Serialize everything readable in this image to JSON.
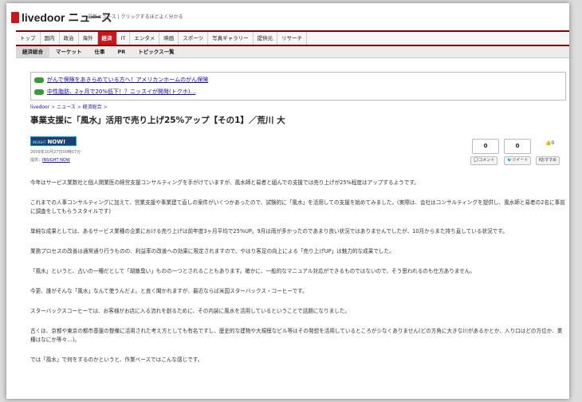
{
  "header": {
    "logo_text": "livedoor ニュース",
    "tagline": "最新ニュース | クリックするほどよく分かる"
  },
  "nav": {
    "items": [
      "トップ",
      "国内",
      "政治",
      "海外",
      "経済",
      "IT",
      "エンタメ",
      "映画",
      "スポーツ",
      "写真ギャラリー",
      "提供元",
      "リサーチ"
    ],
    "active": "経済"
  },
  "subnav": {
    "items": [
      "経済総合",
      "マーケット",
      "仕事",
      "PR",
      "トピックス一覧"
    ],
    "active": "経済総合"
  },
  "promo": {
    "links": [
      "がんで保険をあきらめている方へ！アメリカンホームのがん保険",
      "中性脂肪、2ヶ月で20%低下！？ニッスイが開発(トクホ)…"
    ]
  },
  "breadcrumb": [
    "livedoor",
    "ニュース",
    "経済総合"
  ],
  "article": {
    "title": "事業支援に「風水」活用で売り上げ25%アップ【その1】／荒川 大",
    "badge_small": "INSIGHT",
    "badge_text": "NOW!",
    "date": "2009年10月27日00時07分",
    "author_label": "提供：",
    "author_link": "INSIGHT NOW",
    "paragraphs": [
      "今年はサービス業数社と個人開業医の経営支援コンサルティングを手がけていますが、風水師と易者と組んでの支援では売り上げが25%程度はアップするようです。",
      "これまでの人事コンサルティングに加えて、営業支援や事業建て直しの案件がいくつかあったので、試験的に「風水」を活用しての支援を始めてみました。(実際は、会社はコンサルティングを提供し、風水師と易者の2名に事前に調査をしてもらうスタイルです)",
      "単純な成果としては、あるサービス業種の企業における売り上げは前年度3ヶ月平均で25%UP。9月は雨が多かったのであまり良い状況ではありませんでしたが、10月からまた持ち直している状況です。",
      "業務プロセスの改善は通常通り行うものの、利益率の改善への効果に限定されますので、やはり客足の向上による「売り上げUP」は魅力的な成果でした。",
      "「風水」というと、占いの一種だとして「胡散臭い」ものの一つとされることもあります。確かに、一般的なマニュアル対応ができるものではないので、そう思われるのも仕方ありません。",
      "今更、誰がそんな「風水」なんて使うんだよ。と良く聞かれますが、最近ならば米国スターバックス・コーヒーです。",
      "スターバックスコーヒーでは、お客様がお店に入る流れを創るために、その内装に風水を活用しているということで話題になりました。",
      "古くは、京都や東京の都市基盤の整備に活用された考え方としても有名ですし、歴史的な建物や大規模なビル等はその発想を活用しているところが少なくありません(どの方角に大きな川があるかとか、入り口はどの方位か、業種はなにか等々…)。",
      "では「風水」で何をするのかというと、作業ベースではこんな感じです。"
    ]
  },
  "social": {
    "comment_count": "0",
    "tweet_count": "0",
    "like_count": "0",
    "comment_label": "コメント",
    "tweet_label": "ツイート",
    "like_label": "おすすめ"
  },
  "colors": {
    "accent": "#c8161d",
    "nav_border": "#8b0000",
    "link": "#1a0dab"
  }
}
